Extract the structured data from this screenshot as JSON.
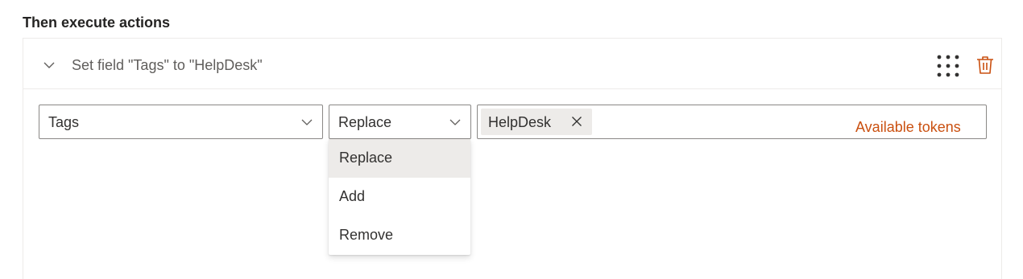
{
  "section": {
    "title": "Then execute actions"
  },
  "action": {
    "title": "Set field \"Tags\" to \"HelpDesk\"",
    "field_select": {
      "value": "Tags"
    },
    "operation_select": {
      "value": "Replace",
      "options": [
        "Replace",
        "Add",
        "Remove"
      ],
      "highlighted": "Replace"
    },
    "value_input": {
      "tags": [
        "HelpDesk"
      ]
    },
    "tokens_link": "Available tokens"
  },
  "icons": {
    "collapse": "chevron-down-icon",
    "drag": "grip-dots-icon",
    "delete": "trash-icon",
    "dropdown_caret": "chevron-down-icon",
    "tag_remove": "close-icon"
  },
  "colors": {
    "accent": "#ca5010",
    "border": "#8a8886",
    "selected_bg": "#edebe9"
  }
}
